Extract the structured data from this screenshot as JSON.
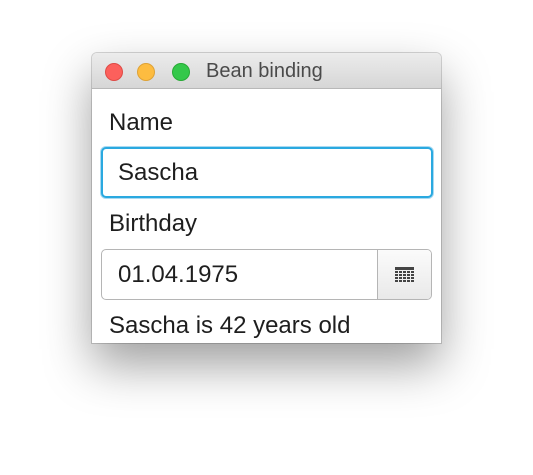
{
  "window": {
    "title": "Bean binding"
  },
  "form": {
    "name_label": "Name",
    "name_value": "Sascha",
    "birthday_label": "Birthday",
    "birthday_value": "01.04.1975",
    "calendar_icon": "calendar-icon"
  },
  "result": {
    "text": "Sascha is 42 years old"
  },
  "colors": {
    "focus_ring": "#2aa9e0",
    "close": "#fc605c",
    "minimize": "#fdbc40",
    "maximize": "#34c84a"
  }
}
